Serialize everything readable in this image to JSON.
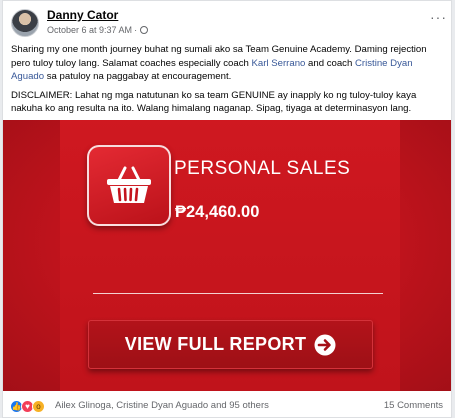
{
  "post": {
    "author": "Danny Cator",
    "timestamp": "October 6 at 9:37 AM",
    "more_label": "···",
    "caption_1_a": "Sharing my one month journey buhat ng sumali ako sa Team Genuine Academy. Daming rejection pero tuloy tuloy lang. Salamat coaches especially coach ",
    "caption_1_link1": "Karl Serrano",
    "caption_1_b": " and coach ",
    "caption_1_link2": "Cristine Dyan Aguado",
    "caption_1_c": " sa patuloy na paggabay at encouragement.",
    "caption_2": "DISCLAIMER: Lahat ng mga natutunan ko sa team GENUINE ay inapply ko ng tuloy-tuloy kaya nakuha ko ang resulta na ito. Walang himalang naganap. Sipag, tiyaga at determinasyon lang."
  },
  "card": {
    "title": "PERSONAL SALES",
    "amount": "₱24,460.00",
    "button_label": "VIEW FULL REPORT"
  },
  "footer": {
    "reactions": [
      "like",
      "love",
      "wow"
    ],
    "likers": "Ailex Glinoga, Cristine Dyan Aguado and 95 others",
    "comments": "15 Comments"
  },
  "colors": {
    "brand_red": "#c4141d",
    "link": "#385898"
  }
}
